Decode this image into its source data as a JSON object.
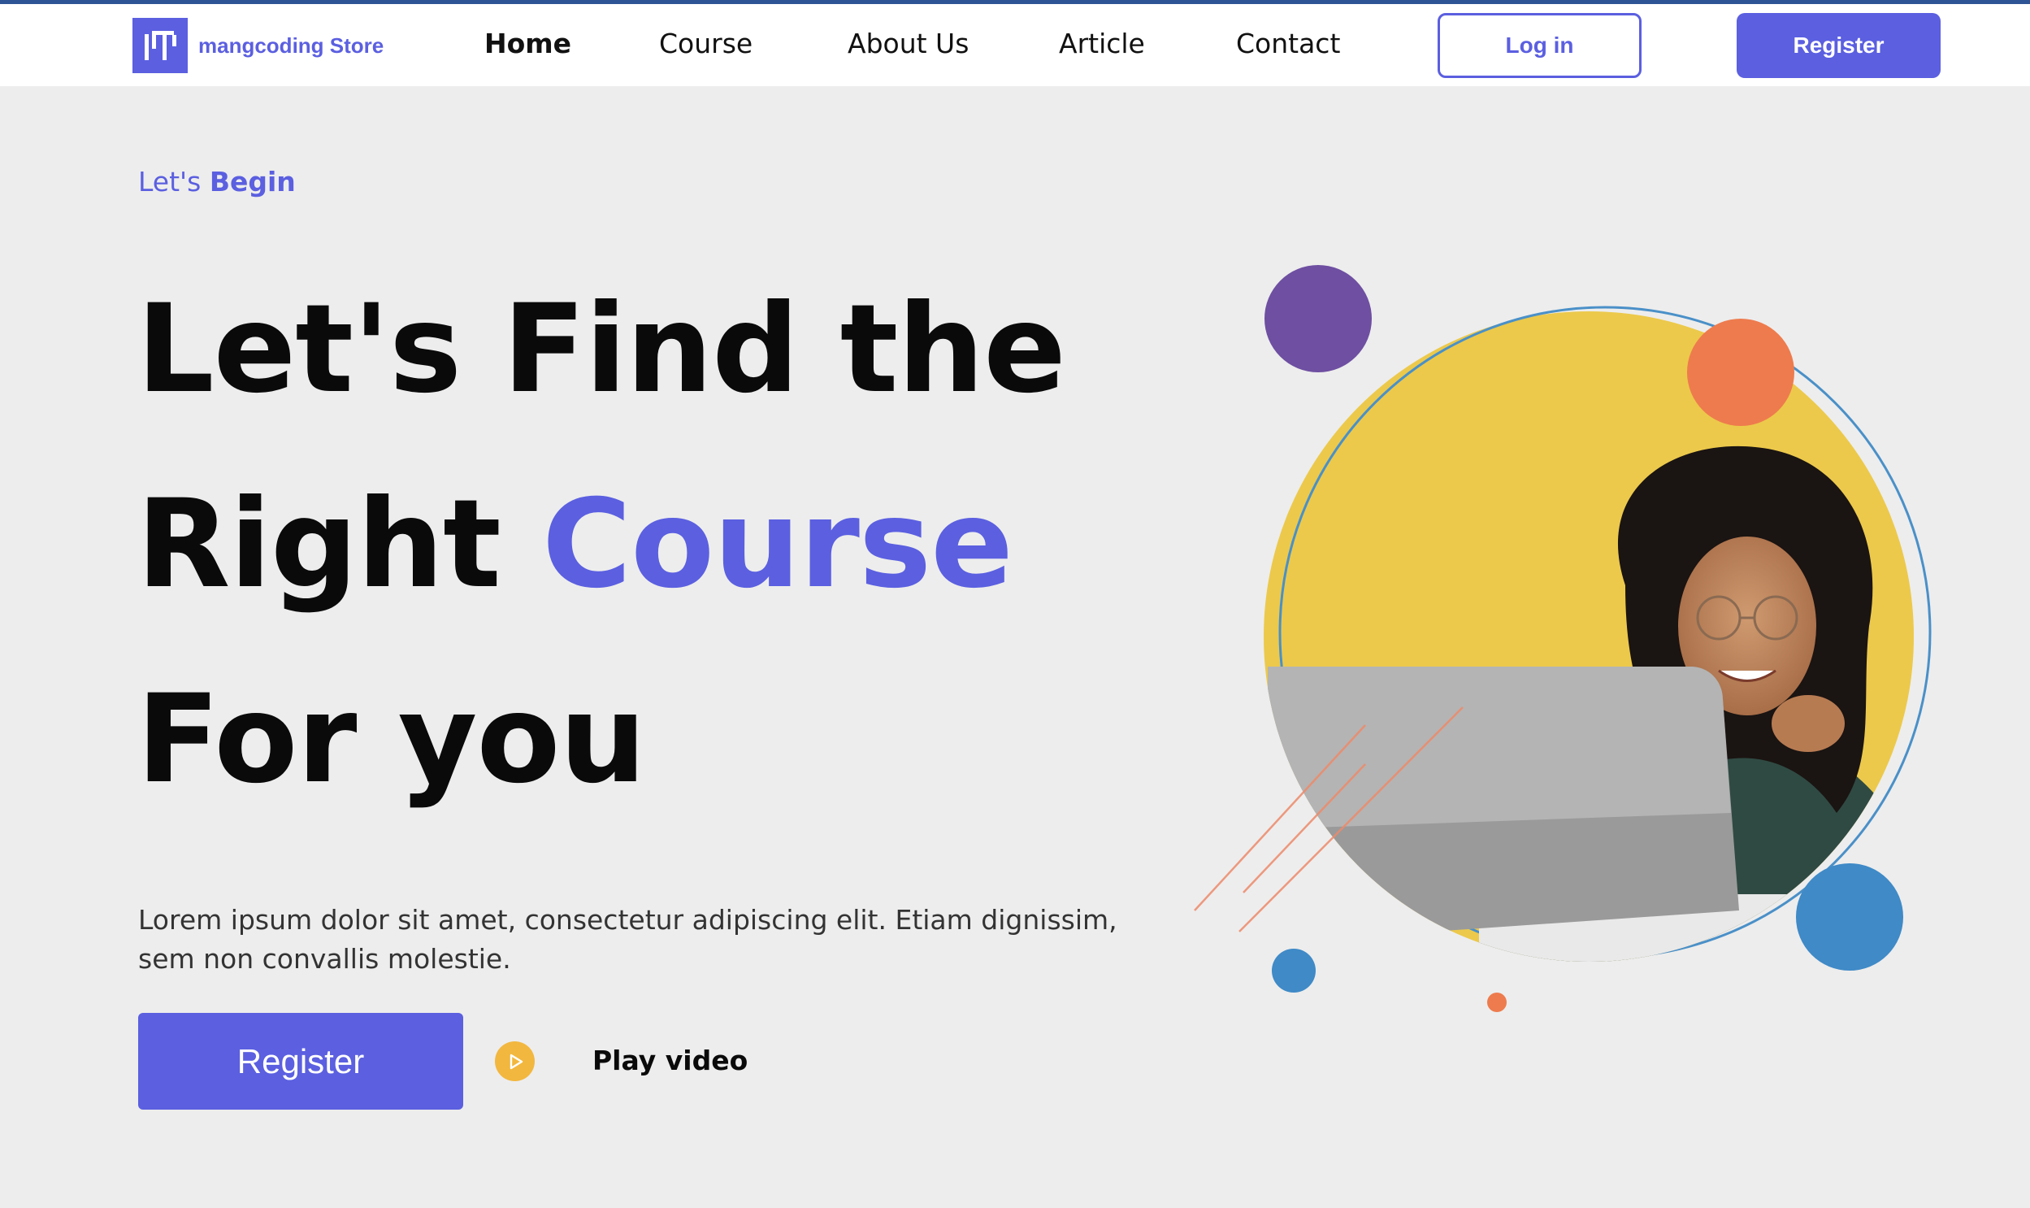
{
  "nav": {
    "logo_text": "mangcoding Store",
    "links": [
      "Home",
      "Course",
      "About Us",
      "Article",
      "Contact"
    ],
    "login_label": "Log in",
    "register_label": "Register"
  },
  "hero": {
    "eyebrow_prefix": "Let's",
    "eyebrow_bold": "Begin",
    "headline_line1": "Let's Find the",
    "headline_line2_plain": "Right",
    "headline_line2_accent": "Course",
    "headline_line3": "For you",
    "description": "Lorem ipsum dolor sit amet, consectetur adipiscing elit. Etiam dignissim, sem non convallis molestie.",
    "register_label": "Register",
    "play_label": "Play video"
  },
  "colors": {
    "accent": "#5b5fe0",
    "yellow": "#ecc94b",
    "orange": "#ee7b4d",
    "purple": "#6e4fa1",
    "blue": "#3f8ac7",
    "play": "#f2b73f"
  },
  "icons": {
    "logo": "mangcoding-logo-icon",
    "play": "play-icon"
  }
}
